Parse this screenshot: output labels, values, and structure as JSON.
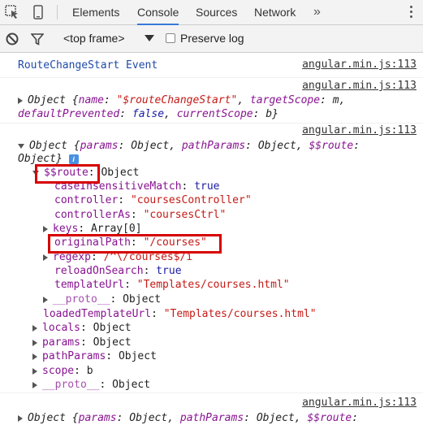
{
  "tabs": {
    "elements": "Elements",
    "console": "Console",
    "sources": "Sources",
    "network": "Network",
    "more": "»"
  },
  "toolbar": {
    "frame": "<top frame>",
    "preserve_log": "Preserve log"
  },
  "messages": {
    "m1": {
      "text": "RouteChangeStart Event",
      "source": "angular.min.js:113"
    },
    "m2": {
      "source": "angular.min.js:113",
      "line1": "Object {name: \"$routeChangeStart\", targetScope: m,",
      "line1_parts": {
        "head": "Object {",
        "k1": "name",
        "v1": "\"$routeChangeStart\"",
        "sep1": ", ",
        "k2": "targetScope",
        "v2": "m,",
        "colon": ": "
      },
      "line2_parts": {
        "k1": "defaultPrevented",
        "v1": "false",
        "k2": "currentScope",
        "v2": "b}"
      }
    },
    "m3": {
      "source": "angular.min.js:113",
      "line1_parts": {
        "head": "Object {",
        "k1": "params",
        "v1": "Object",
        "k2": "pathParams",
        "v2": "Object",
        "k3": "$$route",
        "colon": ":"
      },
      "line2": "Object}",
      "info": "i",
      "route_key": "$$route",
      "route_val": "Object",
      "props": {
        "caseInsensitiveMatch": {
          "k": "caseInsensitiveMatch",
          "v": "true"
        },
        "controller": {
          "k": "controller",
          "v": "\"coursesController\""
        },
        "controllerAs": {
          "k": "controllerAs",
          "v": "\"coursesCtrl\""
        },
        "keys": {
          "k": "keys",
          "v": "Array[0]"
        },
        "originalPath": {
          "k": "originalPath",
          "v": "\"/courses\""
        },
        "regexp": {
          "k": "regexp",
          "v": "/^\\/courses$/i"
        },
        "reloadOnSearch": {
          "k": "reloadOnSearch",
          "v": "true"
        },
        "templateUrl": {
          "k": "templateUrl",
          "v": "\"Templates/courses.html\""
        },
        "proto_inner": {
          "k": "__proto__",
          "v": "Object"
        },
        "loadedTemplateUrl": {
          "k": "loadedTemplateUrl",
          "v": "\"Templates/courses.html\""
        },
        "locals": {
          "k": "locals",
          "v": "Object"
        },
        "params": {
          "k": "params",
          "v": "Object"
        },
        "pathParams": {
          "k": "pathParams",
          "v": "Object"
        },
        "scope": {
          "k": "scope",
          "v": "b"
        },
        "proto_outer": {
          "k": "__proto__",
          "v": "Object"
        }
      }
    },
    "m4": {
      "source": "angular.min.js:113",
      "line1_parts": {
        "head": "Object {",
        "k1": "params",
        "v1": "Object",
        "k2": "pathParams",
        "v2": "Object",
        "k3": "$$route",
        "colon": ":"
      }
    }
  },
  "colors": {
    "highlight": "#d60000",
    "key": "#881391",
    "string": "#c41a16",
    "keyword": "#1a1aa6"
  }
}
